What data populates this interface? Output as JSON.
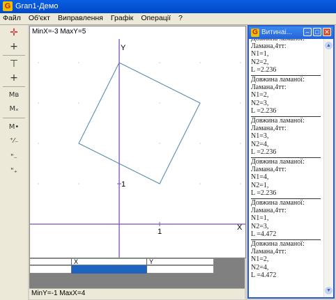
{
  "window": {
    "title": "Gran1-Демо",
    "icon": "app-g-icon",
    "icon_letter": "G"
  },
  "menu": [
    "Файл",
    "Об'єкт",
    "Виправлення",
    "Графік",
    "Операції",
    "?"
  ],
  "toolbar": [
    {
      "name": "point-red-icon",
      "glyph": "✛"
    },
    {
      "name": "crosshair-icon",
      "glyph": "+"
    },
    {
      "name": "point-move-icon",
      "glyph": "⊤"
    },
    {
      "name": "point-add-icon",
      "glyph": "+"
    },
    {
      "name": "segment-mb-icon",
      "glyph": "Mв"
    },
    {
      "name": "segment-mx-icon",
      "glyph": "Mₓ"
    },
    {
      "name": "marker-m-icon",
      "glyph": "M•"
    },
    {
      "name": "scale-icon",
      "glyph": "⁺⁄₋"
    },
    {
      "name": "zoom-out-icon",
      "glyph": "\"₋"
    },
    {
      "name": "zoom-in-icon",
      "glyph": "\"₊"
    }
  ],
  "graph": {
    "range_top": "MinX=-3  MaxY=5",
    "axis_x_label": "X",
    "axis_y_label": "Y",
    "tick_x_label": "1",
    "tick_y_label": "1",
    "xlim": [
      -3,
      4
    ],
    "ylim": [
      -1,
      5
    ],
    "polygon": [
      [
        0,
        4
      ],
      [
        2,
        3
      ],
      [
        1,
        1
      ],
      [
        -1,
        2
      ]
    ],
    "axis_color": "#7b4fb8",
    "shape_color": "#5a8ab0"
  },
  "point_table": {
    "col_x": "X",
    "col_y": "Y"
  },
  "status": {
    "range_bottom": "MinY=-1  MaxX=4"
  },
  "results_window": {
    "title": "Витинаі...",
    "icon_letter": "G",
    "entries": [
      {
        "head": "Довжина ламаної:",
        "name": "Ламана,4тт:",
        "n1": "N1=1,",
        "n2": "N2=2,",
        "l": "L =2.236"
      },
      {
        "head": "Довжина ламаної:",
        "name": "Ламана,4тт:",
        "n1": "N1=2,",
        "n2": "N2=3,",
        "l": "L =2.236"
      },
      {
        "head": "Довжина ламаної:",
        "name": "Ламана,4тт:",
        "n1": "N1=3,",
        "n2": "N2=4,",
        "l": "L =2.236"
      },
      {
        "head": "Довжина ламаної:",
        "name": "Ламана,4тт:",
        "n1": "N1=4,",
        "n2": "N2=1,",
        "l": "L =2.236"
      },
      {
        "head": "Довжина ламаної:",
        "name": "Ламана,4тт:",
        "n1": "N1=1,",
        "n2": "N2=3,",
        "l": "L =4.472"
      },
      {
        "head": "Довжина ламаної:",
        "name": "Ламана,4тт:",
        "n1": "N1=2,",
        "n2": "N2=4,",
        "l": "L =4.472"
      }
    ]
  }
}
